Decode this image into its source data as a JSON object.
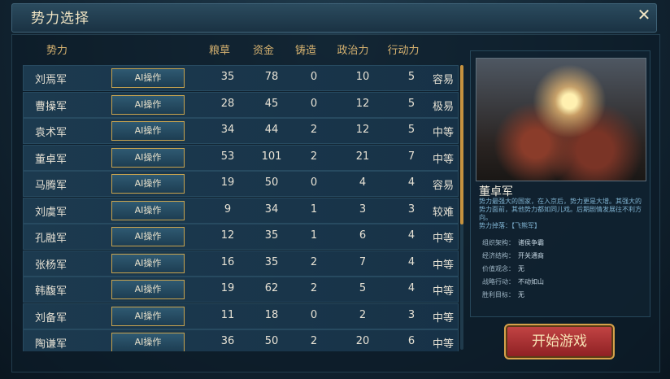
{
  "window": {
    "title": "势力选择"
  },
  "table": {
    "headers": [
      "势力",
      "粮草",
      "资金",
      "铸造",
      "政治力",
      "行动力"
    ],
    "ai_label": "AI操作",
    "rows": [
      {
        "name": "刘焉军",
        "grain": "35",
        "money": "78",
        "cast": "0",
        "politics": "10",
        "action": "5",
        "difficulty": "容易"
      },
      {
        "name": "曹操军",
        "grain": "28",
        "money": "45",
        "cast": "0",
        "politics": "12",
        "action": "5",
        "difficulty": "极易"
      },
      {
        "name": "袁术军",
        "grain": "34",
        "money": "44",
        "cast": "2",
        "politics": "12",
        "action": "5",
        "difficulty": "中等"
      },
      {
        "name": "董卓军",
        "grain": "53",
        "money": "101",
        "cast": "2",
        "politics": "21",
        "action": "7",
        "difficulty": "中等"
      },
      {
        "name": "马腾军",
        "grain": "19",
        "money": "50",
        "cast": "0",
        "politics": "4",
        "action": "4",
        "difficulty": "容易"
      },
      {
        "name": "刘虞军",
        "grain": "9",
        "money": "34",
        "cast": "1",
        "politics": "3",
        "action": "3",
        "difficulty": "较难"
      },
      {
        "name": "孔融军",
        "grain": "12",
        "money": "35",
        "cast": "1",
        "politics": "6",
        "action": "4",
        "difficulty": "中等"
      },
      {
        "name": "张杨军",
        "grain": "16",
        "money": "35",
        "cast": "2",
        "politics": "7",
        "action": "4",
        "difficulty": "中等"
      },
      {
        "name": "韩馥军",
        "grain": "19",
        "money": "62",
        "cast": "2",
        "politics": "5",
        "action": "4",
        "difficulty": "中等"
      },
      {
        "name": "刘备军",
        "grain": "11",
        "money": "18",
        "cast": "0",
        "politics": "2",
        "action": "3",
        "difficulty": "中等"
      },
      {
        "name": "陶谦军",
        "grain": "36",
        "money": "50",
        "cast": "2",
        "politics": "20",
        "action": "6",
        "difficulty": "中等"
      }
    ]
  },
  "detail": {
    "name": "董卓军",
    "desc": "势力最强大的国家，在入京后，势力更是大增。其强大的势力面前，其他势力都如同儿戏。后期剧情发展往不利方向。",
    "drop": "势力掉落：【飞熊军】",
    "items": [
      {
        "k": "组织架构：",
        "v": "诸侯争霸"
      },
      {
        "k": "经济结构：",
        "v": "开关通商"
      },
      {
        "k": "价值观念：",
        "v": "无"
      },
      {
        "k": "战略行动：",
        "v": "不动如山"
      },
      {
        "k": "胜利目标：",
        "v": "无"
      }
    ]
  },
  "actions": {
    "start": "开始游戏"
  }
}
